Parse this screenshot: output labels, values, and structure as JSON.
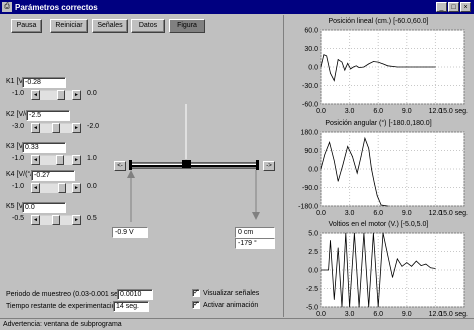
{
  "window": {
    "title": "Parámetros correctos",
    "icon": "app-icon",
    "controls": [
      "_",
      "□",
      "×"
    ]
  },
  "toolbar": {
    "buttons": [
      {
        "label": "Pausa",
        "pressed": false
      },
      {
        "label": "Reiniciar",
        "pressed": false
      },
      {
        "label": "Señales",
        "pressed": false
      },
      {
        "label": "Datos",
        "pressed": false
      },
      {
        "label": "Figura",
        "pressed": true
      }
    ]
  },
  "params": [
    {
      "label": "K1 [V/cm]:",
      "value": "-0.28",
      "min": "-1.0",
      "max": "0.0",
      "level": 0.72
    },
    {
      "label": "K2 [V/cm/s]:",
      "value": "-2.5",
      "min": "-3.0",
      "max": "-2.0",
      "level": 0.5
    },
    {
      "label": "K3 [V/°]:",
      "value": "0.33",
      "min": "-1.0",
      "max": "1.0",
      "level": 0.66
    },
    {
      "label": "K4 [V/(°/s)]:",
      "value": "-0.27",
      "min": "-1.0",
      "max": "0.0",
      "level": 0.73
    },
    {
      "label": "K5 [V/cm]:",
      "value": "0.0",
      "min": "-0.5",
      "max": "0.5",
      "level": 0.5
    }
  ],
  "beam": {
    "left_button": "<-",
    "right_button": "->",
    "voltage": "-0.9 V",
    "position": "0 cm",
    "angle": "-179 °"
  },
  "sampling": {
    "label": "Periodo de muestreo (0.03-0.001 seg.):",
    "value": "0.0010"
  },
  "remaining": {
    "label": "Tiempo restante de experimentación:",
    "value": "14 seg."
  },
  "options": [
    {
      "label": "Visualizar señales",
      "checked": true
    },
    {
      "label": "Activar animación",
      "checked": true
    }
  ],
  "charts": [
    {
      "title": "Posición lineal (cm.)  [-60.0,60.0]",
      "yticks": [
        "60.0",
        "30.0",
        "0.0",
        "-30.0",
        "-60.0"
      ],
      "xticks": [
        "0.0",
        "3.0",
        "6.0",
        "9.0",
        "12.0",
        "15.0 seg."
      ]
    },
    {
      "title": "Posición angular (°)  [-180.0,180.0]",
      "yticks": [
        "180.0",
        "90.0",
        "0.0",
        "-90.0",
        "-180.0"
      ],
      "xticks": [
        "0.0",
        "3.0",
        "6.0",
        "9.0",
        "12.0",
        "15.0 seg."
      ]
    },
    {
      "title": "Voltios en el motor (V.)  [-5.0,5.0]",
      "yticks": [
        "5.0",
        "2.5",
        "0.0",
        "-2.5",
        "-5.0"
      ],
      "xticks": [
        "0.0",
        "3.0",
        "6.0",
        "9.0",
        "12.0",
        "15.0 seg."
      ]
    }
  ],
  "chart_data": [
    {
      "type": "line",
      "title": "Posición lineal (cm.)  [-60.0,60.0]",
      "xlabel": "seg.",
      "xlim": [
        0,
        15
      ],
      "ylim": [
        -60,
        60
      ],
      "x": [
        0,
        0.3,
        0.6,
        1.0,
        1.4,
        1.8,
        2.2,
        2.5,
        2.8,
        3.1,
        3.4,
        3.7,
        4.0,
        4.5,
        5.0,
        5.5,
        6.0,
        6.5,
        7.0,
        8.0,
        9.0,
        10.0,
        11.0,
        12.0
      ],
      "y": [
        0,
        20,
        18,
        -10,
        -22,
        12,
        8,
        -5,
        6,
        -3,
        0,
        2,
        -1,
        0,
        5,
        9,
        8,
        5,
        2,
        0,
        0,
        0,
        0,
        0
      ]
    },
    {
      "type": "line",
      "title": "Posición angular (°)  [-180.0,180.0]",
      "xlabel": "seg.",
      "xlim": [
        0,
        15
      ],
      "ylim": [
        -180,
        180
      ],
      "x": [
        0,
        0.4,
        0.9,
        1.4,
        1.8,
        2.3,
        2.8,
        3.3,
        3.8,
        4.2,
        4.6,
        5.0,
        5.3,
        5.6,
        5.9,
        6.3,
        7.0
      ],
      "y": [
        0,
        70,
        130,
        40,
        -60,
        20,
        110,
        60,
        -20,
        60,
        150,
        100,
        0,
        -70,
        -130,
        -175,
        -180
      ]
    },
    {
      "type": "line",
      "title": "Voltios en el motor (V.)  [-5.0,5.0]",
      "xlabel": "seg.",
      "xlim": [
        0,
        15
      ],
      "ylim": [
        -5,
        5
      ],
      "x": [
        0,
        0.8,
        1.0,
        1.4,
        1.8,
        2.2,
        2.6,
        3.0,
        3.5,
        4.0,
        4.5,
        5.0,
        5.5,
        6.0,
        6.5,
        7.0,
        7.5,
        8.0,
        8.5,
        9.0,
        9.5,
        10.0,
        10.5,
        11.0,
        11.5,
        12.0
      ],
      "y": [
        0,
        0,
        4,
        -4,
        3,
        -5,
        5,
        -5,
        5,
        -5,
        5,
        -5,
        5,
        -5,
        5,
        2,
        -1,
        1.5,
        0.5,
        1,
        0.5,
        1.2,
        0.6,
        0.8,
        0.3,
        0.2
      ]
    }
  ],
  "status": {
    "text": "Advertencia: ventana de subprograma"
  }
}
